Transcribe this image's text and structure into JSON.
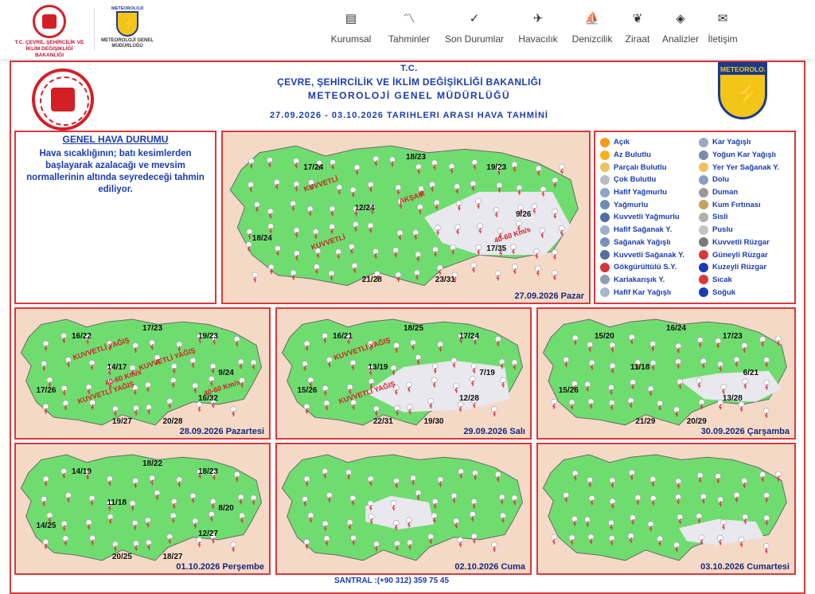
{
  "header": {
    "logo1_text": "T.C. ÇEVRE, ŞEHİRCİLİK VE İKLİM DEĞİŞİKLİĞİ BAKANLIĞI",
    "logo2_top": "METEOROLOJİ",
    "logo2_text": "METEOROLOJİ GENEL MÜDÜRLÜĞÜ",
    "nav": [
      {
        "label": "Kurumsal",
        "icon": "document-icon"
      },
      {
        "label": "Tahminler",
        "icon": "chart-icon"
      },
      {
        "label": "Son Durumlar",
        "icon": "check-circle-icon"
      },
      {
        "label": "Havacılık",
        "icon": "airplane-icon"
      },
      {
        "label": "Denizcilik",
        "icon": "sailboat-icon"
      },
      {
        "label": "Ziraat",
        "icon": "wheat-icon"
      },
      {
        "label": "Analizler",
        "icon": "analysis-icon"
      },
      {
        "label": "İletişim",
        "icon": "envelope-icon"
      }
    ]
  },
  "forecast": {
    "t1": "T.C.",
    "t2": "ÇEVRE, ŞEHİRCİLİK VE İKLİM DEĞİŞİKLİĞİ BAKANLIĞI",
    "t3": "METEOROLOJİ GENEL MÜDÜRLÜĞÜ",
    "t4": "27.09.2026 - 03.10.2026 TARIHLERI ARASI HAVA TAHMİNİ",
    "met_logo_text": "METEOROLOJİ",
    "general_title": "GENEL HAVA DURUMU",
    "general_text": "Hava sıcaklığının; batı kesimlerden başlayarak azalacağı ve mevsim normallerinin altında seyredeceği tahmin ediliyor.",
    "colors": {
      "green": "#6fdc6f",
      "peach": "#f4d9c6",
      "gray": "#e8e8ee",
      "red": "#d9383a",
      "blue": "#1a3bb3"
    },
    "main_map": {
      "date": "27.09.2026 Pazar",
      "temps": [
        "17/24",
        "18/23",
        "19/23",
        "12/24",
        "9/26",
        "18/24",
        "17/35",
        "21/28",
        "23/31"
      ],
      "warn_labels": [
        "KUVVETLİ",
        "KUVVETLİ",
        "AKŞAM",
        "40-60 Km/s"
      ]
    },
    "days": [
      {
        "date": "28.09.2026 Pazartesi",
        "temps": [
          "16/22",
          "17/23",
          "19/23",
          "14/17",
          "9/24",
          "17/26",
          "16/32",
          "19/27",
          "20/28"
        ],
        "warn_labels": [
          "KUVVETLİ YAĞIŞ",
          "KUVVETLİ YAĞIŞ",
          "KUVVETLİ YAĞIŞ",
          "40-60 Km/s",
          "40-60 Km/s"
        ]
      },
      {
        "date": "29.09.2026 Salı",
        "temps": [
          "16/21",
          "18/25",
          "17/24",
          "13/19",
          "7/19",
          "15/26",
          "12/28",
          "22/31",
          "19/30"
        ],
        "warn_labels": [
          "KUVVETLİ YAĞIŞ",
          "KUVVETLİ YAĞIŞ"
        ]
      },
      {
        "date": "30.09.2026 Çarşamba",
        "temps": [
          "15/20",
          "16/24",
          "17/23",
          "11/18",
          "6/21",
          "15/26",
          "13/28",
          "21/29",
          "20/29"
        ],
        "warn_labels": []
      },
      {
        "date": "01.10.2026 Perşembe",
        "temps": [
          "14/19",
          "18/22",
          "18/23",
          "11/18",
          "8/20",
          "14/25",
          "12/27",
          "20/25",
          "18/27"
        ],
        "warn_labels": []
      },
      {
        "date": "02.10.2026 Cuma",
        "temps": [],
        "warn_labels": []
      },
      {
        "date": "03.10.2026 Cumartesi",
        "temps": [],
        "warn_labels": []
      }
    ],
    "legend_left": [
      {
        "label": "Açık",
        "icon": "sun-icon",
        "color": "#f59a1b"
      },
      {
        "label": "Az Bulutlu",
        "icon": "sun-cloud-icon",
        "color": "#f5b01b"
      },
      {
        "label": "Parçalı Bulutlu",
        "icon": "partly-cloudy-icon",
        "color": "#f0c060"
      },
      {
        "label": "Çok Bulutlu",
        "icon": "cloud-icon",
        "color": "#b9bcc4"
      },
      {
        "label": "Hafif Yağmurlu",
        "icon": "light-rain-icon",
        "color": "#8da6c8"
      },
      {
        "label": "Yağmurlu",
        "icon": "rain-icon",
        "color": "#6f8bb5"
      },
      {
        "label": "Kuvvetli Yağmurlu",
        "icon": "heavy-rain-icon",
        "color": "#4d6fa5"
      },
      {
        "label": "Hafif Sağanak Y.",
        "icon": "light-shower-icon",
        "color": "#9fb0c9"
      },
      {
        "label": "Sağanak Yağışlı",
        "icon": "shower-icon",
        "color": "#7a91b8"
      },
      {
        "label": "Kuvvetli Sağanak Y.",
        "icon": "heavy-shower-icon",
        "color": "#56709e"
      },
      {
        "label": "Gökgürültülü S.Y.",
        "icon": "thunder-icon",
        "color": "#d4363b"
      },
      {
        "label": "Karlakarışık Y.",
        "icon": "sleet-icon",
        "color": "#8f9db5"
      },
      {
        "label": "Hafif Kar Yağışlı",
        "icon": "light-snow-icon",
        "color": "#a9b6cf"
      }
    ],
    "legend_right": [
      {
        "label": "Kar Yağışlı",
        "icon": "snow-icon",
        "color": "#9aa8c2"
      },
      {
        "label": "Yoğun Kar Yağışlı",
        "icon": "heavy-snow-icon",
        "color": "#7c8cab"
      },
      {
        "label": "Yer Yer Sağanak Y.",
        "icon": "scattered-shower-icon",
        "color": "#f0c060"
      },
      {
        "label": "Dolu",
        "icon": "hail-icon",
        "color": "#8aa0c0"
      },
      {
        "label": "Duman",
        "icon": "smoke-icon",
        "color": "#9a9a9a"
      },
      {
        "label": "Kum Fırtınası",
        "icon": "sandstorm-icon",
        "color": "#c9a15a"
      },
      {
        "label": "Sisli",
        "icon": "fog-icon",
        "color": "#b0b0b0"
      },
      {
        "label": "Puslu",
        "icon": "haze-icon",
        "color": "#c4c4c4"
      },
      {
        "label": "Kuvvetli Rüzgar",
        "icon": "strong-wind-icon",
        "color": "#7a7a7a"
      },
      {
        "label": "Güneyli Rüzgar",
        "icon": "south-wind-arrow-icon",
        "color": "#d9383a"
      },
      {
        "label": "Kuzeyli Rüzgar",
        "icon": "north-wind-arrow-icon",
        "color": "#1a3bb3"
      },
      {
        "label": "Sıcak",
        "icon": "hot-thermometer-icon",
        "color": "#d9383a"
      },
      {
        "label": "Soğuk",
        "icon": "cold-thermometer-icon",
        "color": "#1a3bb3"
      }
    ],
    "footer": "SANTRAL :(+90 312) 359 75 45"
  }
}
